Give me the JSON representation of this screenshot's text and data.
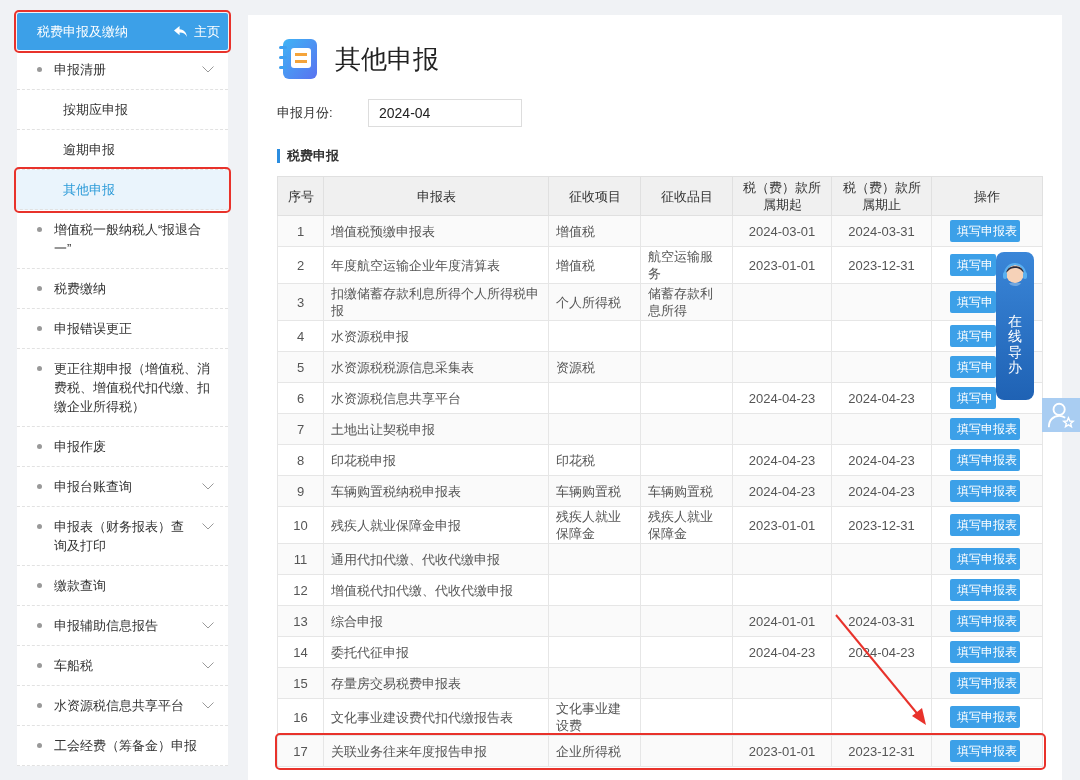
{
  "sidebar": {
    "header": {
      "title": "税费申报及缴纳",
      "home_link": "主页",
      "highlighted": true
    },
    "items": [
      {
        "label": "申报清册",
        "expandable": true,
        "selected": false,
        "highlighted": false,
        "children": [
          {
            "label": "按期应申报",
            "selected": false,
            "highlighted": false
          },
          {
            "label": "逾期申报",
            "selected": false,
            "highlighted": false
          },
          {
            "label": "其他申报",
            "selected": true,
            "highlighted": true
          }
        ]
      },
      {
        "label": "增值税一般纳税人“报退合一”",
        "expandable": false,
        "selected": false,
        "highlighted": false
      },
      {
        "label": "税费缴纳",
        "expandable": false,
        "selected": false,
        "highlighted": false
      },
      {
        "label": "申报错误更正",
        "expandable": false,
        "selected": false,
        "highlighted": false
      },
      {
        "label": "更正往期申报（增值税、消费税、增值税代扣代缴、扣缴企业所得税）",
        "expandable": false,
        "selected": false,
        "highlighted": false
      },
      {
        "label": "申报作废",
        "expandable": false,
        "selected": false,
        "highlighted": false
      },
      {
        "label": "申报台账查询",
        "expandable": true,
        "selected": false,
        "highlighted": false
      },
      {
        "label": "申报表（财务报表）查询及打印",
        "expandable": true,
        "selected": false,
        "highlighted": false
      },
      {
        "label": "缴款查询",
        "expandable": false,
        "selected": false,
        "highlighted": false
      },
      {
        "label": "申报辅助信息报告",
        "expandable": true,
        "selected": false,
        "highlighted": false
      },
      {
        "label": "车船税",
        "expandable": true,
        "selected": false,
        "highlighted": false
      },
      {
        "label": "水资源税信息共享平台",
        "expandable": true,
        "selected": false,
        "highlighted": false
      },
      {
        "label": "工会经费（筹备金）申报",
        "expandable": false,
        "selected": false,
        "highlighted": false
      }
    ]
  },
  "page": {
    "title": "其他申报",
    "month_label": "申报月份:",
    "month_value": "2024-04",
    "section_title": "税费申报"
  },
  "table": {
    "columns": [
      "序号",
      "申报表",
      "征收项目",
      "征收品目",
      "税（费）款所属期起",
      "税（费）款所属期止",
      "操作"
    ],
    "rows": [
      {
        "no": "1",
        "form": "增值税预缴申报表",
        "item": "增值税",
        "start": "2024-03-01",
        "end": "2024-03-31",
        "action": "填写申报表",
        "highlighted": false
      },
      {
        "no": "2",
        "form": "年度航空运输企业年度清算表",
        "item": "增值税",
        "subitem": "航空运输服务",
        "start": "2023-01-01",
        "end": "2023-12-31",
        "action": "填写申",
        "highlighted": false
      },
      {
        "no": "3",
        "form": "扣缴储蓄存款利息所得个人所得税申报",
        "item": "个人所得税",
        "subitem": "储蓄存款利息所得",
        "action": "填写申",
        "highlighted": false
      },
      {
        "no": "4",
        "form": "水资源税申报",
        "action": "填写申",
        "highlighted": false
      },
      {
        "no": "5",
        "form": "水资源税税源信息采集表",
        "item": "资源税",
        "action": "填写申",
        "highlighted": false
      },
      {
        "no": "6",
        "form": "水资源税信息共享平台",
        "start": "2024-04-23",
        "end": "2024-04-23",
        "action": "填写申",
        "highlighted": false
      },
      {
        "no": "7",
        "form": "土地出让契税申报",
        "action": "填写申报表",
        "highlighted": false
      },
      {
        "no": "8",
        "form": "印花税申报",
        "item": "印花税",
        "start": "2024-04-23",
        "end": "2024-04-23",
        "action": "填写申报表",
        "highlighted": false
      },
      {
        "no": "9",
        "form": "车辆购置税纳税申报表",
        "item": "车辆购置税",
        "subitem": "车辆购置税",
        "start": "2024-04-23",
        "end": "2024-04-23",
        "action": "填写申报表",
        "highlighted": false
      },
      {
        "no": "10",
        "form": "残疾人就业保障金申报",
        "item": "残疾人就业保障金",
        "subitem": "残疾人就业保障金",
        "start": "2023-01-01",
        "end": "2023-12-31",
        "action": "填写申报表",
        "highlighted": false
      },
      {
        "no": "11",
        "form": "通用代扣代缴、代收代缴申报",
        "action": "填写申报表",
        "highlighted": false
      },
      {
        "no": "12",
        "form": "增值税代扣代缴、代收代缴申报",
        "action": "填写申报表",
        "highlighted": false
      },
      {
        "no": "13",
        "form": "综合申报",
        "start": "2024-01-01",
        "end": "2024-03-31",
        "action": "填写申报表",
        "highlighted": false
      },
      {
        "no": "14",
        "form": "委托代征申报",
        "start": "2024-04-23",
        "end": "2024-04-23",
        "action": "填写申报表",
        "highlighted": false
      },
      {
        "no": "15",
        "form": "存量房交易税费申报表",
        "action": "填写申报表",
        "highlighted": false
      },
      {
        "no": "16",
        "form": "文化事业建设费代扣代缴报告表",
        "item": "文化事业建设费",
        "action": "填写申报表",
        "highlighted": false
      },
      {
        "no": "17",
        "form": "关联业务往来年度报告申报",
        "item": "企业所得税",
        "start": "2023-01-01",
        "end": "2023-12-31",
        "action": "填写申报表",
        "highlighted": true
      }
    ]
  },
  "online_guide": {
    "label": "在线导办"
  }
}
